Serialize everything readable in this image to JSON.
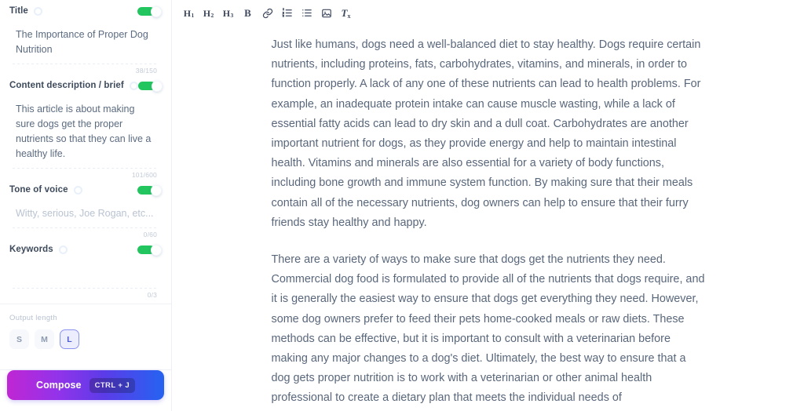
{
  "sidebar": {
    "fields": [
      {
        "label": "Title",
        "info_icon": "info-icon",
        "toggle_on": true,
        "value": "The Importance of Proper Dog Nutrition",
        "placeholder": "",
        "counter": "38/150"
      },
      {
        "label": "Content description / brief",
        "info_icon": "info-icon",
        "toggle_on": true,
        "value": "This article is about making sure dogs get the proper nutrients so that they can live a healthy life.",
        "placeholder": "",
        "counter": "101/600"
      },
      {
        "label": "Tone of voice",
        "info_icon": "info-icon",
        "toggle_on": true,
        "value": "",
        "placeholder": "Witty, serious, Joe Rogan, etc...",
        "counter": "0/60"
      },
      {
        "label": "Keywords",
        "info_icon": "info-icon",
        "toggle_on": true,
        "value": "",
        "placeholder": "",
        "counter": "0/3"
      }
    ],
    "output_length": {
      "title": "Output length",
      "options": [
        {
          "label": "S",
          "selected": false
        },
        {
          "label": "M",
          "selected": false
        },
        {
          "label": "L",
          "selected": true
        }
      ]
    },
    "compose": {
      "label": "Compose",
      "shortcut": "CTRL + J",
      "gradient_from": "#c026d3",
      "gradient_to": "#2563f0"
    }
  },
  "toolbar": {
    "items": [
      {
        "name": "heading-1",
        "type": "heading",
        "text": "H",
        "sub": "1"
      },
      {
        "name": "heading-2",
        "type": "heading",
        "text": "H",
        "sub": "2"
      },
      {
        "name": "heading-3",
        "type": "heading",
        "text": "H",
        "sub": "3"
      },
      {
        "name": "bold",
        "type": "bold",
        "text": "B",
        "sub": ""
      },
      {
        "name": "link-icon",
        "type": "link",
        "text": "",
        "sub": ""
      },
      {
        "name": "ordered-list-icon",
        "type": "ordered-list",
        "text": "",
        "sub": ""
      },
      {
        "name": "bullet-list-icon",
        "type": "bullet-list",
        "text": "",
        "sub": ""
      },
      {
        "name": "image-icon",
        "type": "image",
        "text": "",
        "sub": ""
      },
      {
        "name": "clear-formatting",
        "type": "clear",
        "text": "T",
        "sub": "x"
      }
    ]
  },
  "document": {
    "paragraphs": [
      "Just like humans, dogs need a well-balanced diet to stay healthy. Dogs require certain nutrients, including proteins, fats, carbohydrates, vitamins, and minerals, in order to function properly. A lack of any one of these nutrients can lead to health problems. For example, an inadequate protein intake can cause muscle wasting, while a lack of essential fatty acids can lead to dry skin and a dull coat. Carbohydrates are another important nutrient for dogs, as they provide energy and help to maintain intestinal health. Vitamins and minerals are also essential for a variety of body functions, including bone growth and immune system function. By making sure that their meals contain all of the necessary nutrients, dog owners can help to ensure that their furry friends stay healthy and happy.",
      "There are a variety of ways to make sure that dogs get the nutrients they need. Commercial dog food is formulated to provide all of the nutrients that dogs require, and it is generally the easiest way to ensure that dogs get everything they need. However, some dog owners prefer to feed their pets home-cooked meals or raw diets. These methods can be effective, but it is important to consult with a veterinarian before making any major changes to a dog's diet. Ultimately, the best way to ensure that a dog gets proper nutrition is to work with a veterinarian or other animal health professional to create a dietary plan that meets the individual needs of"
    ]
  },
  "colors": {
    "toggle_on": "#22c55e",
    "selected_size": "#4f5bd5",
    "text": "#59677b"
  }
}
